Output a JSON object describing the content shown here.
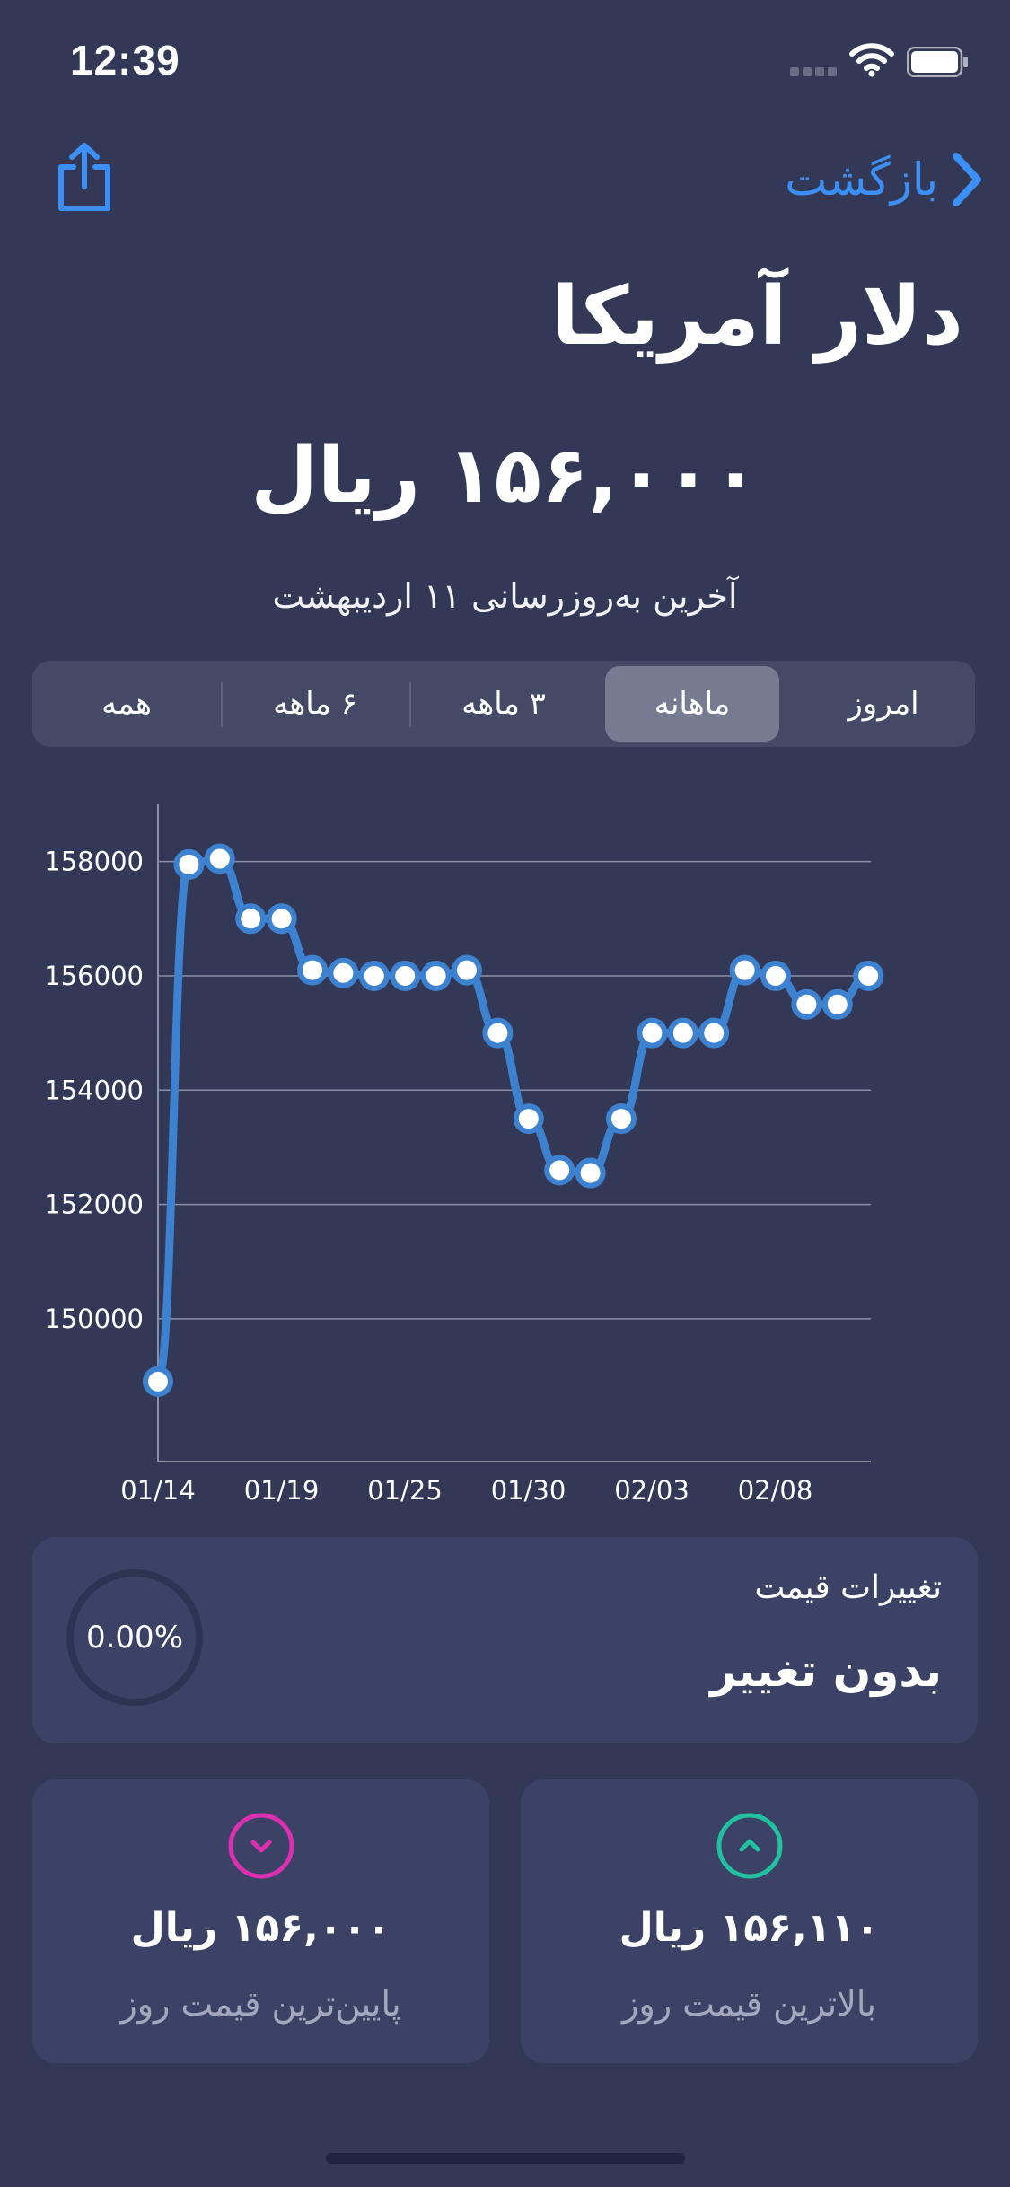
{
  "status_bar": {
    "time": "12:39"
  },
  "nav": {
    "back_label": "بازگشت",
    "share_icon": "share-icon"
  },
  "header": {
    "title": "دلار آمریکا",
    "price": "۱۵۶,۰۰۰ ریال",
    "updated": "آخرین به‌روزرسانی ۱۱ اردیبهشت"
  },
  "tabs": [
    {
      "label": "امروز"
    },
    {
      "label": "ماهانه",
      "selected": true
    },
    {
      "label": "۳ ماهه"
    },
    {
      "label": "۶ ماهه"
    },
    {
      "label": "همه"
    }
  ],
  "chart_data": {
    "type": "line",
    "x_tick_labels": [
      "01/14",
      "01/19",
      "01/25",
      "01/30",
      "02/03",
      "02/08"
    ],
    "y_ticks": [
      150000,
      152000,
      154000,
      156000,
      158000
    ],
    "ylim": [
      147500,
      159000
    ],
    "values": [
      148900,
      157950,
      158050,
      157000,
      157000,
      156100,
      156050,
      156000,
      156000,
      156000,
      156100,
      155000,
      153500,
      152600,
      152550,
      153500,
      155000,
      155000,
      155000,
      156100,
      156000,
      155500,
      155500,
      156000
    ],
    "grid": true,
    "line_color": "#3d82d0"
  },
  "change_card": {
    "title": "تغییرات قیمت",
    "status": "بدون تغییر",
    "percent": "0.00%"
  },
  "low_card": {
    "value": "۱۵۶,۰۰۰ ریال",
    "label": "پایین‌ترین قیمت روز",
    "color": "#dc2fb1"
  },
  "high_card": {
    "value": "۱۵۶,۱۱۰ ریال",
    "label": "بالاترین قیمت روز",
    "color": "#21c1a0"
  }
}
